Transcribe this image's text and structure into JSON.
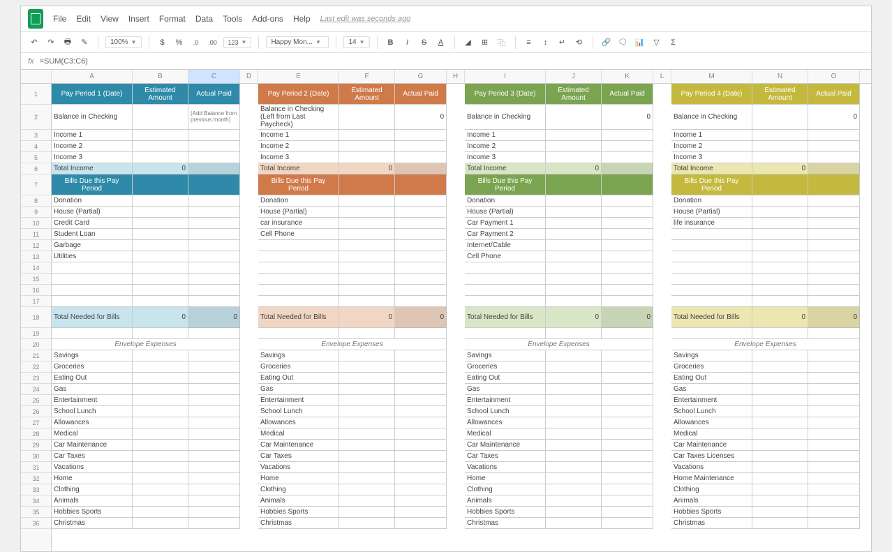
{
  "menus": [
    "File",
    "Edit",
    "View",
    "Insert",
    "Format",
    "Data",
    "Tools",
    "Add-ons",
    "Help"
  ],
  "lastEdit": "Last edit was seconds ago",
  "zoom": "100%",
  "fontName": "Happy Mon...",
  "fontSize": "14",
  "formula": "=SUM(C3:C6)",
  "columns": [
    "A",
    "B",
    "C",
    "D",
    "E",
    "F",
    "G",
    "H",
    "I",
    "J",
    "K",
    "L",
    "M",
    "N",
    "O"
  ],
  "envelopeHeader": "Envelope Expenses",
  "envelopeRows": [
    "Savings",
    "Groceries",
    "Eating Out",
    "Gas",
    "Entertainment",
    "School Lunch",
    "Allowances",
    "Medical",
    "Car Maintenance",
    "Car Taxes",
    "Vacations",
    "Home",
    "Clothing",
    "Animals",
    "Hobbies Sports",
    "Christmas"
  ],
  "totalNeededLabel": "Total Needed for Bills",
  "blocks": [
    {
      "theme": "teal",
      "h1": "Pay Period 1 (Date)",
      "h2": "Estimated Amount",
      "h3": "Actual Paid",
      "balanceLabel": "Balance in Checking",
      "balanceNote": "(Add Balance from previous month)",
      "balanceVal": "",
      "incomes": [
        "Income 1",
        "Income 2",
        "Income 3"
      ],
      "totalIncomeLabel": "Total Income",
      "totalIncomeVal": "0",
      "billsHeader": "Bills Due this Pay Period",
      "bills": [
        "Donation",
        "House (Partial)",
        "Credit Card",
        "Student Loan",
        "Garbage",
        "Utilities"
      ],
      "envelopeTaxes": "Car Taxes",
      "envelopeHome": "Home"
    },
    {
      "theme": "orange",
      "h1": "Pay Period 2 (Date)",
      "h2": "Estimated Amount",
      "h3": "Actual Paid",
      "balanceLabel": "Balance in Checking (Left from Last Paycheck)",
      "balanceNote": "",
      "balanceVal": "0",
      "incomes": [
        "Income 1",
        "Income 2",
        "Income 3"
      ],
      "totalIncomeLabel": "Total Income",
      "totalIncomeVal": "0",
      "billsHeader": "Bills Due this Pay Period",
      "bills": [
        "Donation",
        "House (Partial)",
        "car insurance",
        "Cell Phone"
      ],
      "envelopeTaxes": "Car Taxes",
      "envelopeHome": "Home"
    },
    {
      "theme": "green",
      "h1": "Pay Period 3 (Date)",
      "h2": "Estimated Amount",
      "h3": "Actual Paid",
      "balanceLabel": "Balance in Checking",
      "balanceNote": "",
      "balanceVal": "0",
      "incomes": [
        "Income 1",
        "Income 2",
        "Income 3"
      ],
      "totalIncomeLabel": "Total Income",
      "totalIncomeVal": "0",
      "billsHeader": "Bills Due this Pay Period",
      "bills": [
        "Donation",
        "House (Partial)",
        "Car Payment 1",
        "Car Payment 2",
        "Internet/Cable",
        "Cell Phone"
      ],
      "envelopeTaxes": "Car Taxes",
      "envelopeHome": "Home"
    },
    {
      "theme": "yellow",
      "h1": "Pay Period 4 (Date)",
      "h2": "Estimated Amount",
      "h3": "Actual Paid",
      "balanceLabel": "Balance in Checking",
      "balanceNote": "",
      "balanceVal": "0",
      "incomes": [
        "Income 1",
        "Income 2",
        "Income 3"
      ],
      "totalIncomeLabel": "Total Income",
      "totalIncomeVal": "0",
      "billsHeader": "Bills Due this Pay Period",
      "bills": [
        "Donation",
        "House (Partial)",
        "life insurance"
      ],
      "envelopeTaxes": "Car Taxes Licenses",
      "envelopeHome": "Home Maintenance"
    }
  ],
  "rowNumbers": [
    1,
    2,
    3,
    4,
    5,
    6,
    7,
    8,
    9,
    10,
    11,
    12,
    13,
    14,
    15,
    16,
    17,
    18,
    19,
    20,
    21,
    22,
    23,
    24,
    25,
    26,
    27,
    28,
    29,
    30,
    31,
    32,
    33,
    34,
    35,
    36
  ]
}
